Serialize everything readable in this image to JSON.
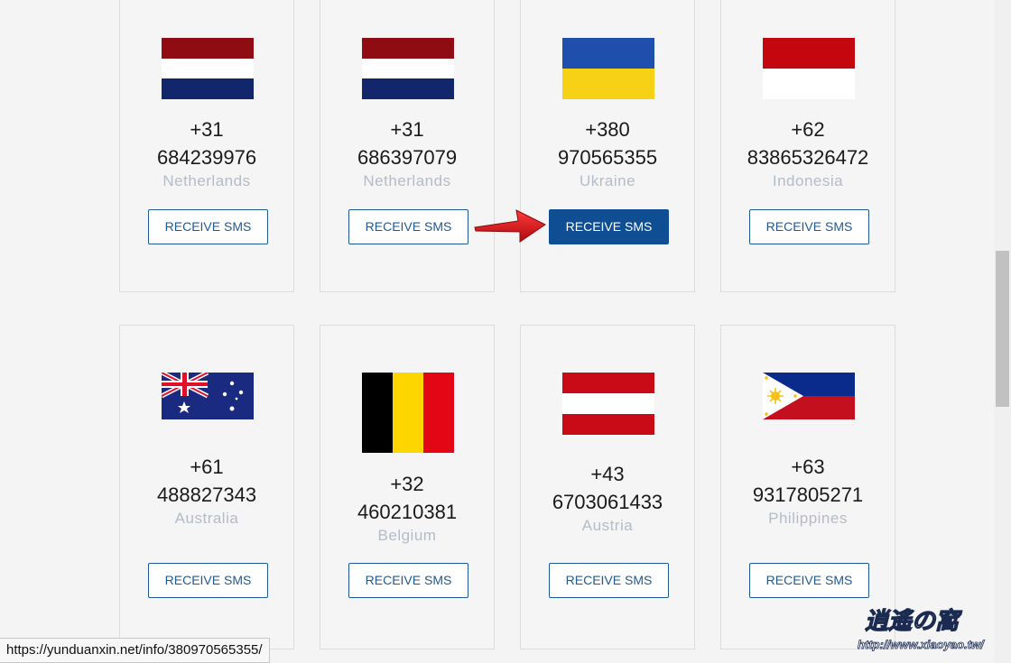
{
  "cards": [
    {
      "code": "+31",
      "number": "684239976",
      "country": "Netherlands",
      "button": "RECEIVE SMS",
      "flag_icon": "netherlands-flag-icon"
    },
    {
      "code": "+31",
      "number": "686397079",
      "country": "Netherlands",
      "button": "RECEIVE SMS",
      "flag_icon": "netherlands-flag-icon"
    },
    {
      "code": "+380",
      "number": "970565355",
      "country": "Ukraine",
      "button": "RECEIVE SMS",
      "flag_icon": "ukraine-flag-icon"
    },
    {
      "code": "+62",
      "number": "83865326472",
      "country": "Indonesia",
      "button": "RECEIVE SMS",
      "flag_icon": "indonesia-flag-icon"
    },
    {
      "code": "+61",
      "number": "488827343",
      "country": "Australia",
      "button": "RECEIVE SMS",
      "flag_icon": "australia-flag-icon"
    },
    {
      "code": "+32",
      "number": "460210381",
      "country": "Belgium",
      "button": "RECEIVE SMS",
      "flag_icon": "belgium-flag-icon"
    },
    {
      "code": "+43",
      "number": "6703061433",
      "country": "Austria",
      "button": "RECEIVE SMS",
      "flag_icon": "austria-flag-icon"
    },
    {
      "code": "+63",
      "number": "9317805271",
      "country": "Philippines",
      "button": "RECEIVE SMS",
      "flag_icon": "philippines-flag-icon"
    }
  ],
  "status_url": "https://yunduanxin.net/info/380970565355/",
  "watermark": "http://www.xiaoyao.tw/",
  "colors": {
    "accent": "#1e5a96",
    "active_button": "#0f4e92",
    "arrow": "#d9141b"
  }
}
